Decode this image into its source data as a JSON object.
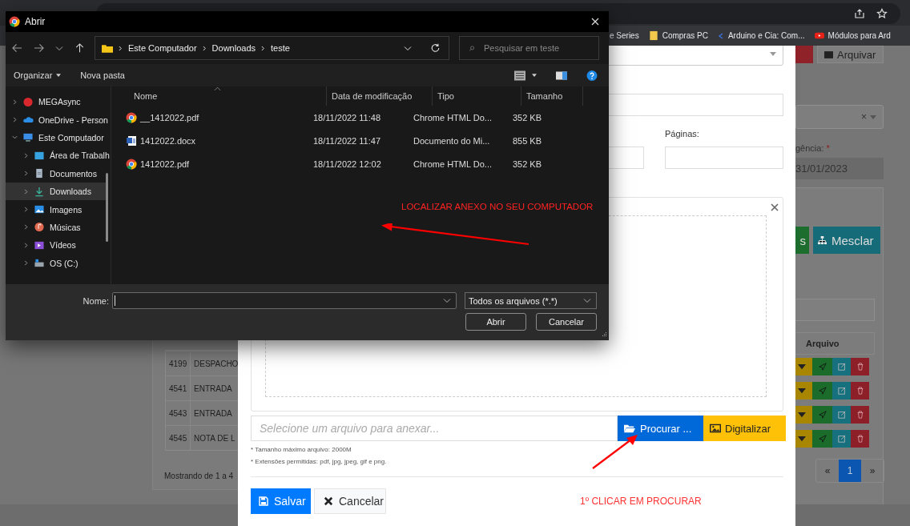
{
  "browser": {
    "bookmarks": [
      {
        "label": "e Series",
        "kind": "plain"
      },
      {
        "label": "Compras PC",
        "kind": "folder"
      },
      {
        "label": "Arduino e Cia: Com...",
        "kind": "site"
      },
      {
        "label": "Módulos para Ard",
        "kind": "video"
      }
    ]
  },
  "background_page": {
    "archive_button": "Arquivar",
    "clear_mark": "×",
    "date_label": "gência:",
    "required_mark": "*",
    "date_value": "31/01/2023",
    "green_button": "s",
    "merge_button": "Mesclar",
    "table_header": "Arquivo",
    "rows": [
      {
        "id": "4199",
        "type": "DESPACHO"
      },
      {
        "id": "4541",
        "type": "ENTRADA"
      },
      {
        "id": "4543",
        "type": "ENTRADA"
      },
      {
        "id": "4545",
        "type": "NOTA DE L"
      }
    ],
    "showing": "Mostrando de 1 a 4",
    "pagination": [
      {
        "label": "«",
        "selected": false
      },
      {
        "label": "1",
        "selected": true
      },
      {
        "label": "»",
        "selected": false
      }
    ]
  },
  "modal": {
    "pages_label": "Páginas:",
    "file_placeholder": "Selecione um arquivo para anexar...",
    "browse_button": "Procurar ...",
    "scan_button": "Digitalizar",
    "hints": [
      "* Tamanho máximo arquivo: 2000M",
      "* Extensões permitidas: pdf, jpg, jpeg, gif e png."
    ],
    "save_button": "Salvar",
    "cancel_button": "Cancelar",
    "annotation": "1º CLICAR EM PROCURAR"
  },
  "dialog": {
    "title": "Abrir",
    "path": [
      "Este Computador",
      "Downloads",
      "teste"
    ],
    "search_placeholder": "Pesquisar em teste",
    "toolbar": {
      "organize": "Organizar",
      "new_folder": "Nova pasta"
    },
    "tree": [
      {
        "label": "MEGAsync",
        "kind": "mega",
        "expanded": false,
        "selected": false
      },
      {
        "label": "OneDrive - Person",
        "kind": "cloud",
        "expanded": false,
        "selected": false
      },
      {
        "label": "Este Computador",
        "kind": "pc",
        "expanded": true,
        "selected": false,
        "children": [
          {
            "label": "Área de Trabalh",
            "kind": "desktop",
            "expanded": false,
            "selected": false
          },
          {
            "label": "Documentos",
            "kind": "documents",
            "expanded": false,
            "selected": false
          },
          {
            "label": "Downloads",
            "kind": "downloads",
            "expanded": false,
            "selected": true
          },
          {
            "label": "Imagens",
            "kind": "pictures",
            "expanded": false,
            "selected": false
          },
          {
            "label": "Músicas",
            "kind": "music",
            "expanded": false,
            "selected": false
          },
          {
            "label": "Vídeos",
            "kind": "videos",
            "expanded": false,
            "selected": false
          },
          {
            "label": "OS (C:)",
            "kind": "drive",
            "expanded": false,
            "selected": false
          }
        ]
      }
    ],
    "columns": [
      "Nome",
      "Data de modificação",
      "Tipo",
      "Tamanho"
    ],
    "files": [
      {
        "name": "__1412022.pdf",
        "kind": "pdf",
        "modified": "18/11/2022 11:48",
        "type": "Chrome HTML Do...",
        "size": "352 KB"
      },
      {
        "name": "1412022.docx",
        "kind": "docx",
        "modified": "18/11/2022 11:47",
        "type": "Documento do Mi...",
        "size": "855 KB"
      },
      {
        "name": "1412022.pdf",
        "kind": "pdf",
        "modified": "18/11/2022 12:02",
        "type": "Chrome HTML Do...",
        "size": "352 KB"
      }
    ],
    "annotation": "LOCALIZAR ANEXO NO SEU COMPUTADOR",
    "name_label": "Nome:",
    "file_type": "Todos os arquivos (*.*)",
    "open_button": "Abrir",
    "cancel_button": "Cancelar"
  }
}
